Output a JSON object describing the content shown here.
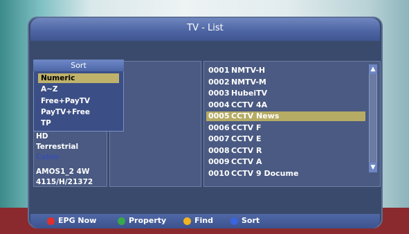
{
  "window": {
    "title": "TV - List"
  },
  "info": {
    "hd": "HD",
    "terrestrial": "Terrestrial",
    "cable": "Cable",
    "satellite": "AMOS1_2 4W",
    "transponder": "4115/H/21372"
  },
  "sort": {
    "title": "Sort",
    "options": [
      "Numeric",
      "A~Z",
      "Free+PayTV",
      "PayTV+Free",
      "TP"
    ],
    "selected_index": 0
  },
  "channels": [
    {
      "num": "0001",
      "name": "NMTV-H"
    },
    {
      "num": "0002",
      "name": "NMTV-M"
    },
    {
      "num": "0003",
      "name": "HubeiTV"
    },
    {
      "num": "0004",
      "name": "CCTV 4A"
    },
    {
      "num": "0005",
      "name": "CCTV News"
    },
    {
      "num": "0006",
      "name": "CCTV F"
    },
    {
      "num": "0007",
      "name": "CCTV E"
    },
    {
      "num": "0008",
      "name": "CCTV R"
    },
    {
      "num": "0009",
      "name": "CCTV A"
    },
    {
      "num": "0010",
      "name": "CCTV 9 Docume"
    }
  ],
  "selected_channel_index": 4,
  "colors": {
    "cable_text": "#3a4fae",
    "selection": "#b5ab64",
    "red": "#e0302a",
    "green": "#3aa84a",
    "yellow": "#f0b420",
    "blue": "#3a64e0"
  },
  "footer": {
    "epg_label": "EPG Now",
    "property_label": "Property",
    "find_label": "Find",
    "sort_label": "Sort"
  }
}
